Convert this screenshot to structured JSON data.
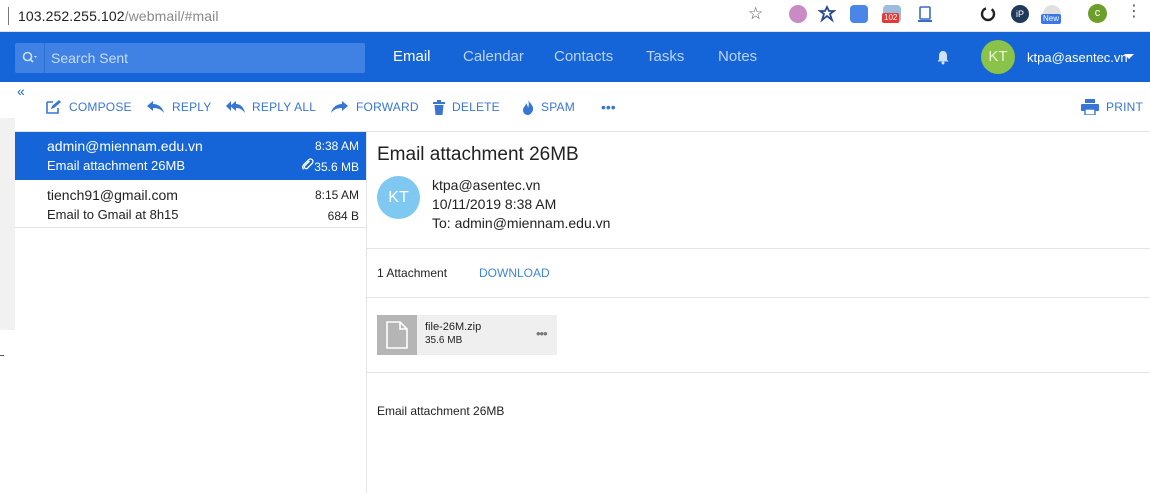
{
  "browser": {
    "url_host": "103.252.255.102",
    "url_path": "/webmail/#mail",
    "ext_badge_count": "102",
    "ext_badge_new": "New",
    "profile_initial": "c"
  },
  "header": {
    "search_placeholder": "Search Sent",
    "tabs": [
      "Email",
      "Calendar",
      "Contacts",
      "Tasks",
      "Notes"
    ],
    "active_tab": "Email",
    "user_initials": "KT",
    "user_email": "ktpa@asentec.vn"
  },
  "toolbar": {
    "compose": "COMPOSE",
    "reply": "REPLY",
    "reply_all": "REPLY ALL",
    "forward": "FORWARD",
    "delete": "DELETE",
    "spam": "SPAM",
    "print": "PRINT"
  },
  "messages": [
    {
      "from": "admin@miennam.edu.vn",
      "subject": "Email attachment 26MB",
      "time": "8:38 AM",
      "size": "35.6 MB",
      "has_attachment": true,
      "selected": true
    },
    {
      "from": "tiench91@gmail.com",
      "subject": "Email to Gmail at 8h15",
      "time": "8:15 AM",
      "size": "684 B",
      "has_attachment": false,
      "selected": false
    }
  ],
  "reading": {
    "subject": "Email attachment 26MB",
    "sender_initials": "KT",
    "sender": "ktpa@asentec.vn",
    "datetime": "10/11/2019 8:38 AM",
    "to": "To: admin@miennam.edu.vn",
    "attachment_count": "1 Attachment",
    "download": "DOWNLOAD",
    "file_name": "file-26M.zip",
    "file_size": "35.6 MB",
    "body": "Email attachment 26MB"
  },
  "colors": {
    "header_blue": "#1565d8",
    "link_blue": "#3876d6",
    "avatar_green": "#8bc34a",
    "sender_avatar_blue": "#7ec8f2"
  }
}
